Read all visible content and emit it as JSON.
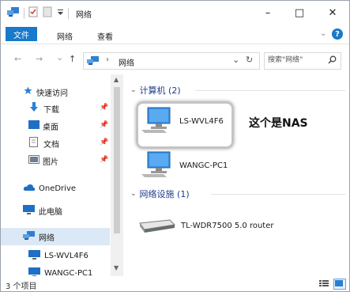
{
  "titlebar": {
    "title": "网络"
  },
  "window_controls": {
    "minimize": "–",
    "maximize": "□",
    "close": "✕"
  },
  "ribbon": {
    "file": "文件",
    "tabs": [
      "网络",
      "查看"
    ]
  },
  "navbar": {
    "back": "←",
    "forward": "→",
    "recent": "⌄",
    "up": "↑",
    "address_separator": "›",
    "address": "网络",
    "refresh": "↻",
    "search_placeholder": "搜索\"网络\""
  },
  "sidebar": {
    "items": [
      {
        "label": "快速访问",
        "icon": "star-icon"
      },
      {
        "label": "下载",
        "icon": "download-icon",
        "pinned": true
      },
      {
        "label": "桌面",
        "icon": "desktop-icon",
        "pinned": true
      },
      {
        "label": "文档",
        "icon": "document-icon",
        "pinned": true
      },
      {
        "label": "图片",
        "icon": "pictures-icon",
        "pinned": true
      },
      {
        "label": "OneDrive",
        "icon": "cloud-icon"
      },
      {
        "label": "此电脑",
        "icon": "computer-icon"
      },
      {
        "label": "网络",
        "icon": "network-icon",
        "selected": true
      },
      {
        "label": "LS-WVL4F6",
        "icon": "computer-icon"
      },
      {
        "label": "WANGC-PC1",
        "icon": "computer-icon"
      }
    ]
  },
  "content": {
    "groups": [
      {
        "label": "计算机 (2)",
        "items": [
          "LS-WVL4F6",
          "WANGC-PC1"
        ]
      },
      {
        "label": "网络设施 (1)",
        "items": [
          "TL-WDR7500 5.0 router"
        ]
      }
    ],
    "annotation": "这个是NAS"
  },
  "statusbar": {
    "count": "3 个项目"
  },
  "colors": {
    "accent": "#1979ca",
    "group_text": "#1e3a8a",
    "selected": "#dbe8f6"
  }
}
